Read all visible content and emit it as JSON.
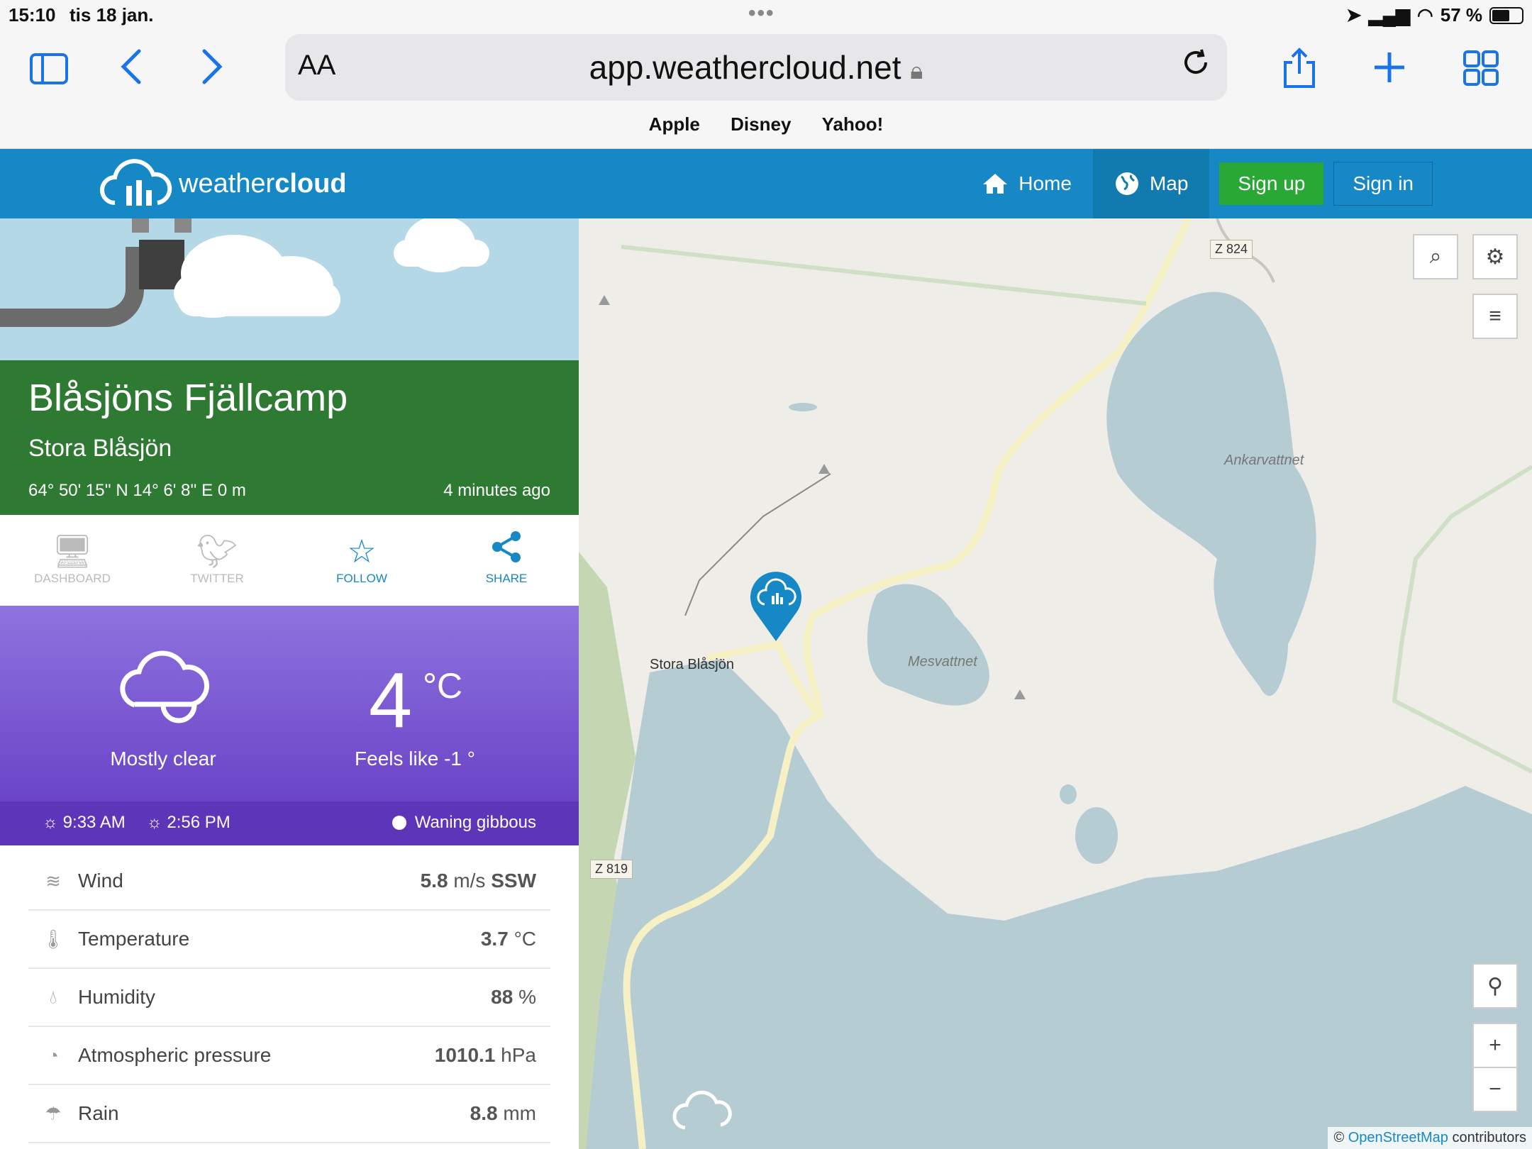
{
  "status": {
    "time": "15:10",
    "date": "tis 18 jan.",
    "battery": "57 %"
  },
  "browser": {
    "url": "app.weathercloud.net",
    "aa": "AA",
    "bookmarks": [
      "Apple",
      "Disney",
      "Yahoo!"
    ]
  },
  "header": {
    "logo_light": "weather",
    "logo_bold": "cloud",
    "nav": {
      "home": "Home",
      "map": "Map",
      "signup": "Sign up",
      "signin": "Sign in"
    }
  },
  "station": {
    "name": "Blåsjöns Fjällcamp",
    "subtitle": "Stora Blåsjön",
    "coords": "64° 50' 15'' N   14° 6' 8'' E   0 m",
    "updated": "4 minutes ago"
  },
  "actions": {
    "dashboard": "DASHBOARD",
    "twitter": "TWITTER",
    "follow": "FOLLOW",
    "share": "SHARE"
  },
  "current": {
    "condition": "Mostly clear",
    "temp": "4",
    "temp_unit": "°C",
    "feels": "Feels like -1 °",
    "sunrise": "9:33 AM",
    "sunset": "2:56 PM",
    "moon": "Waning gibbous"
  },
  "observations": [
    {
      "icon": "wind-icon",
      "label": "Wind",
      "value": "5.8",
      "unit": "m/s",
      "extra": "SSW"
    },
    {
      "icon": "thermometer-icon",
      "label": "Temperature",
      "value": "3.7",
      "unit": "°C",
      "extra": ""
    },
    {
      "icon": "humidity-icon",
      "label": "Humidity",
      "value": "88",
      "unit": "%",
      "extra": ""
    },
    {
      "icon": "pressure-icon",
      "label": "Atmospheric pressure",
      "value": "1010.1",
      "unit": "hPa",
      "extra": ""
    },
    {
      "icon": "umbrella-icon",
      "label": "Rain",
      "value": "8.8",
      "unit": "mm",
      "extra": ""
    }
  ],
  "map": {
    "labels": {
      "town": "Stora Blåsjön",
      "lake1": "Ankarvattnet",
      "lake2": "Mesvattnet",
      "road1": "Z 824",
      "road2": "Z 819"
    },
    "attribution_prefix": "© ",
    "attribution_link": "OpenStreetMap",
    "attribution_suffix": " contributors",
    "colors": {
      "water": "#b6ccd3",
      "land": "#efede8",
      "forest": "#c5d6b3",
      "road": "#f5f1c4",
      "header": "#1688c6"
    }
  }
}
